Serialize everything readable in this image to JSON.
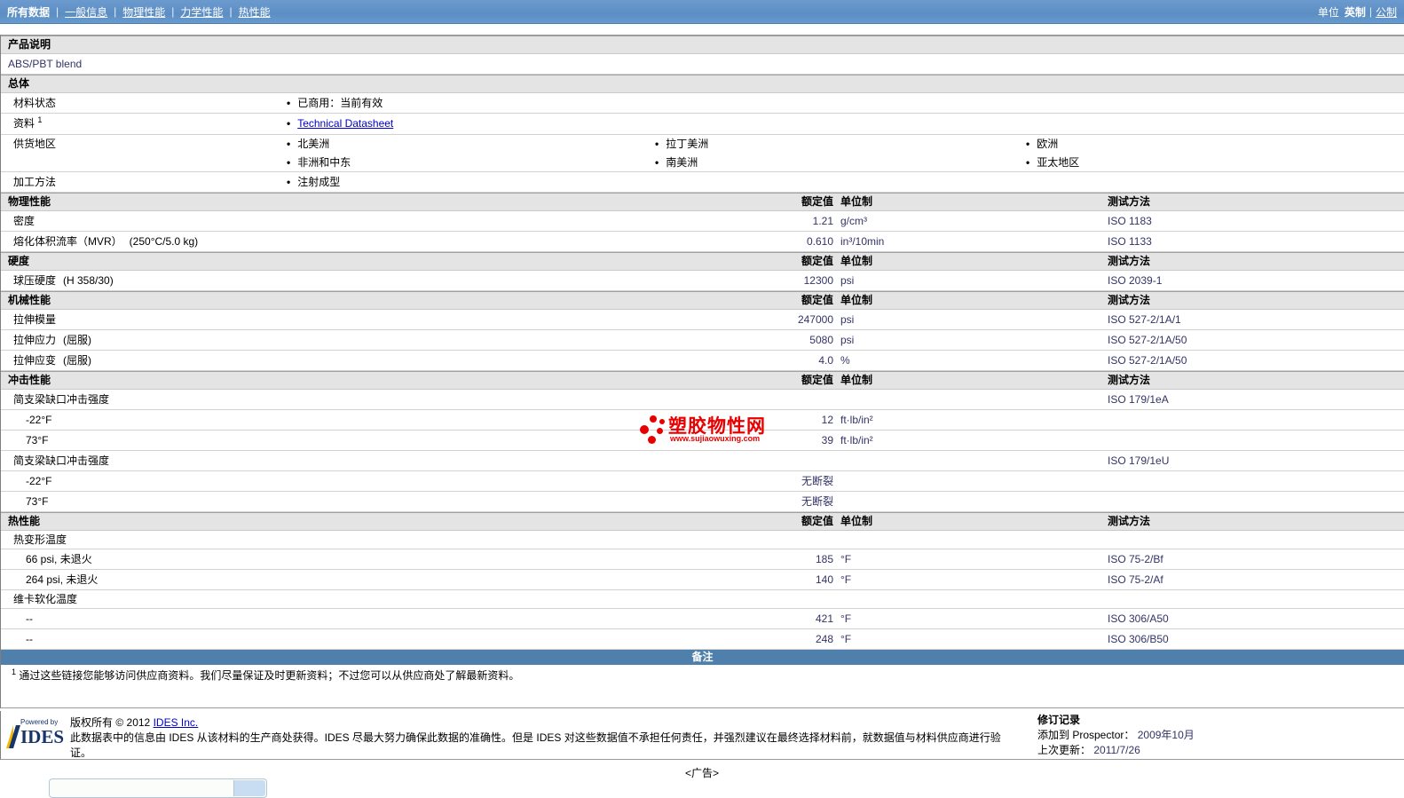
{
  "ui": {
    "bullet": "•"
  },
  "nav": {
    "separator": "|",
    "items": [
      {
        "label": "所有数据",
        "current": true
      },
      {
        "label": "一般信息"
      },
      {
        "label": "物理性能"
      },
      {
        "label": "力学性能"
      },
      {
        "label": "热性能"
      }
    ],
    "units_label": "单位",
    "unit_current": "英制",
    "unit_alt": "公制"
  },
  "product": {
    "section_title": "产品说明",
    "name": "ABS/PBT blend"
  },
  "general": {
    "section_title": "总体",
    "status_label": "材料状态",
    "status_value": "已商用：当前有效",
    "resource_label": "资料",
    "resource_sup": "1",
    "resource_link": "Technical Datasheet",
    "regions_label": "供货地区",
    "regions": [
      [
        "北美洲",
        "拉丁美洲",
        "欧洲"
      ],
      [
        "非洲和中东",
        "南美洲",
        "亚太地区"
      ]
    ],
    "processing_label": "加工方法",
    "processing_value": "注射成型"
  },
  "table": {
    "col_value": "额定值",
    "col_unit": "单位制",
    "col_method": "测试方法",
    "sections": [
      {
        "title": "物理性能",
        "rows": [
          {
            "label": "密度",
            "value": "1.21",
            "unit": "g/cm³",
            "method": "ISO 1183"
          },
          {
            "label": "熔化体积流率（MVR）",
            "cond": "(250°C/5.0 kg)",
            "value": "0.610",
            "unit": "in³/10min",
            "method": "ISO 1133"
          }
        ]
      },
      {
        "title": "硬度",
        "rows": [
          {
            "label": "球压硬度",
            "cond": "(H 358/30)",
            "value": "12300",
            "unit": "psi",
            "method": "ISO 2039-1"
          }
        ]
      },
      {
        "title": "机械性能",
        "rows": [
          {
            "label": "拉伸模量",
            "value": "247000",
            "unit": "psi",
            "method": "ISO 527-2/1A/1"
          },
          {
            "label": "拉伸应力",
            "cond": "(屈服)",
            "value": "5080",
            "unit": "psi",
            "method": "ISO 527-2/1A/50"
          },
          {
            "label": "拉伸应变",
            "cond": "(屈服)",
            "value": "4.0",
            "unit": "%",
            "method": "ISO 527-2/1A/50"
          }
        ]
      },
      {
        "title": "冲击性能",
        "rows": [
          {
            "label": "简支梁缺口冲击强度",
            "method": "ISO 179/1eA"
          },
          {
            "label": "-22°F",
            "indent": true,
            "value": "12",
            "unit": "ft·lb/in²"
          },
          {
            "label": "73°F",
            "indent": true,
            "value": "39",
            "unit": "ft·lb/in²"
          },
          {
            "label": "简支梁缺口冲击强度",
            "method": "ISO 179/1eU"
          },
          {
            "label": "-22°F",
            "indent": true,
            "value": "无断裂"
          },
          {
            "label": "73°F",
            "indent": true,
            "value": "无断裂"
          }
        ]
      },
      {
        "title": "热性能",
        "rows": [
          {
            "label": "热变形温度"
          },
          {
            "label": "66 psi, 未退火",
            "indent": true,
            "value": "185",
            "unit": "°F",
            "method": "ISO 75-2/Bf"
          },
          {
            "label": "264 psi, 未退火",
            "indent": true,
            "value": "140",
            "unit": "°F",
            "method": "ISO 75-2/Af"
          },
          {
            "label": "维卡软化温度"
          },
          {
            "label": "--",
            "indent": true,
            "value": "421",
            "unit": "°F",
            "method": "ISO 306/A50"
          },
          {
            "label": "--",
            "indent": true,
            "value": "248",
            "unit": "°F",
            "method": "ISO 306/B50"
          }
        ]
      }
    ]
  },
  "notes": {
    "bar_title": "备注",
    "footnote_sup": "1",
    "footnote_text": "通过这些链接您能够访问供应商资料。我们尽量保证及时更新资料；不过您可以从供应商处了解最新资料。"
  },
  "watermark": {
    "title": "塑胶物性网",
    "url": "www.sujiaowuxing.com"
  },
  "footer": {
    "powered_by": "Powered by",
    "logo_text": "IDES",
    "copyright_prefix": "版权所有",
    "copyright_year": "© 2012",
    "copyright_link": "IDES Inc.",
    "disclaimer": "此数据表中的信息由 IDES 从该材料的生产商处获得。IDES 尽最大努力确保此数据的准确性。但是 IDES 对这些数据值不承担任何责任，并强烈建议在最终选择材料前，就数据值与材料供应商进行验证。",
    "revision_title": "修订记录",
    "added_label": "添加到 Prospector：",
    "added_value": "2009年10月",
    "updated_label": "上次更新：",
    "updated_value": "2011/7/26"
  },
  "ad": {
    "placeholder": "<广告>"
  }
}
